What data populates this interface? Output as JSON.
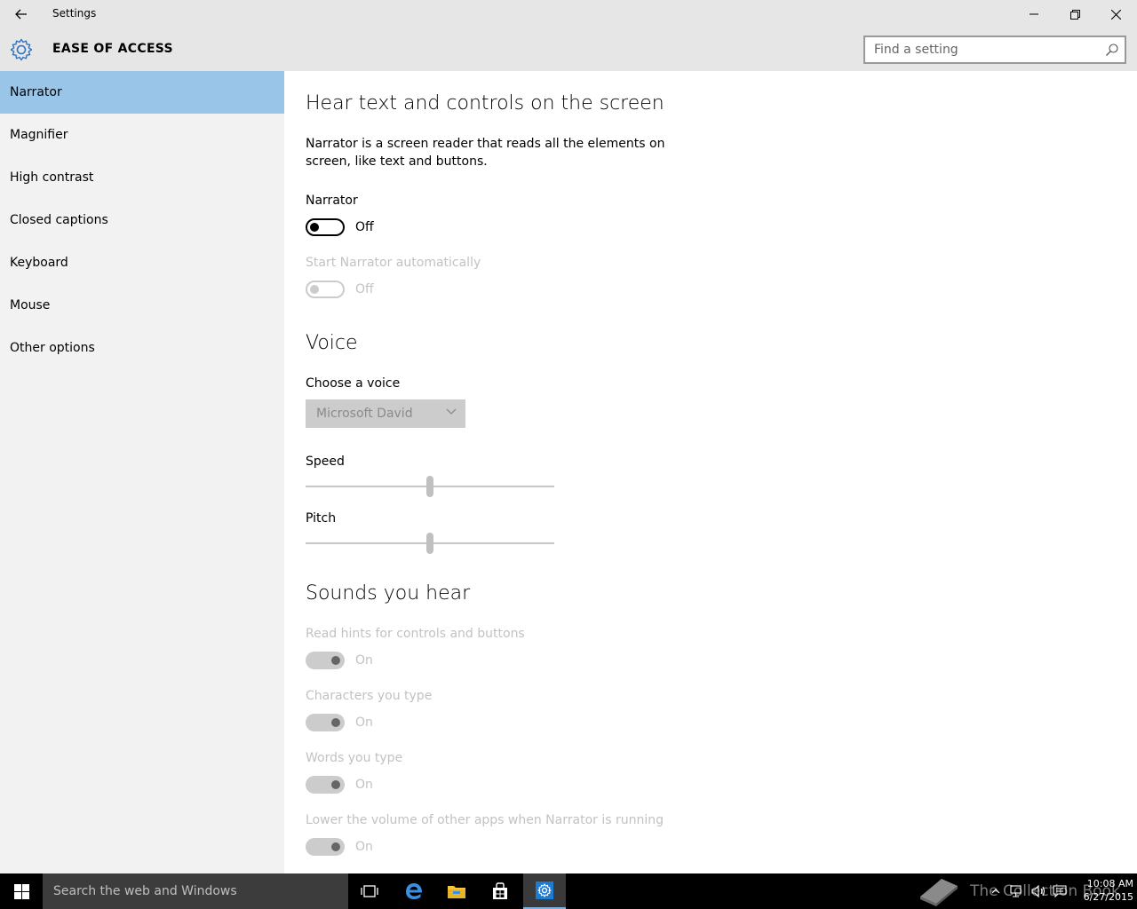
{
  "window": {
    "title": "Settings"
  },
  "header": {
    "section": "EASE OF ACCESS",
    "search_placeholder": "Find a setting"
  },
  "sidebar": {
    "items": [
      {
        "label": "Narrator"
      },
      {
        "label": "Magnifier"
      },
      {
        "label": "High contrast"
      },
      {
        "label": "Closed captions"
      },
      {
        "label": "Keyboard"
      },
      {
        "label": "Mouse"
      },
      {
        "label": "Other options"
      }
    ],
    "active": "Narrator"
  },
  "main": {
    "heading": "Hear text and controls on the screen",
    "description": "Narrator is a screen reader that reads all the elements on screen, like text and buttons.",
    "narrator": {
      "label": "Narrator",
      "state": "Off",
      "enabled": true,
      "on": false
    },
    "start_auto": {
      "label": "Start Narrator automatically",
      "state": "Off",
      "enabled": false,
      "on": false
    },
    "voice_heading": "Voice",
    "voice": {
      "label": "Choose a voice",
      "value": "Microsoft David"
    },
    "speed": {
      "label": "Speed",
      "value_fraction": 0.5
    },
    "pitch": {
      "label": "Pitch",
      "value_fraction": 0.5
    },
    "sounds_heading": "Sounds you hear",
    "sounds": [
      {
        "label": "Read hints for controls and buttons",
        "state": "On"
      },
      {
        "label": "Characters you type",
        "state": "On"
      },
      {
        "label": "Words you type",
        "state": "On"
      },
      {
        "label": "Lower the volume of other apps when Narrator is running",
        "state": "On"
      }
    ]
  },
  "taskbar": {
    "search_text": "Search the web and Windows",
    "clock_time": "10:08 AM",
    "clock_date": "6/27/2015",
    "watermark": "The Collection Book"
  },
  "colors": {
    "accent": "#0078d7",
    "selected_nav": "#99c6e8",
    "chrome": "#e6e6e6",
    "sidebar": "#f2f2f2",
    "disabled_text": "#c2c2c2"
  },
  "icons": {
    "back": "back-arrow-icon",
    "settings": "gear-icon",
    "search": "search-icon",
    "start": "windows-logo-icon",
    "task_view": "task-view-icon",
    "edge": "edge-icon",
    "explorer": "file-explorer-icon",
    "store": "store-icon",
    "settings_app": "settings-app-icon"
  }
}
